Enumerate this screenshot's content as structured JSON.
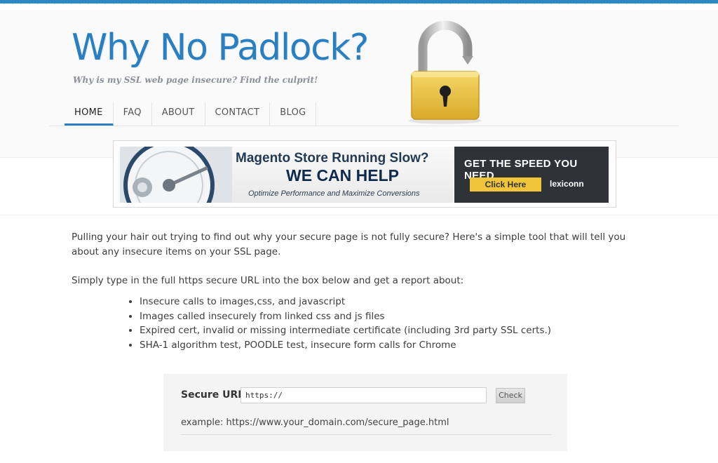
{
  "site": {
    "title": "Why No Padlock?",
    "tagline": "Why is my SSL web page insecure? Find the culprit!",
    "logo_icon": "padlock-icon"
  },
  "nav": {
    "items": [
      {
        "label": "HOME",
        "active": true
      },
      {
        "label": "FAQ"
      },
      {
        "label": "ABOUT"
      },
      {
        "label": "CONTACT"
      },
      {
        "label": "BLOG"
      }
    ]
  },
  "banner": {
    "headline": "Magento Store Running Slow?",
    "subheadline": "WE CAN HELP",
    "tagline": "Optimize Performance and Maximize Conversions",
    "speed": "GET THE SPEED YOU NEED",
    "cta": "Click Here",
    "brand": "lexiconn"
  },
  "content": {
    "intro": "Pulling your hair out trying to find out why your secure page is not fully secure? Here's a simple tool that will tell you about any insecure items on your SSL page.",
    "lead": "Simply type in the full https secure URL into the box below and get a report about:",
    "features": [
      "Insecure calls to images,css, and javascript",
      "Images called insecurely from linked css and js files",
      "Expired cert, invalid or missing intermediate certificate (including 3rd party SSL certs.)",
      "SHA-1 algorithm test, POODLE test, insecure form calls for Chrome"
    ]
  },
  "form": {
    "label": "Secure URL:",
    "input_value": "https://",
    "button": "Check",
    "example": "example: https://www.your_domain.com/secure_page.html"
  },
  "colors": {
    "brand_blue": "#2a7fc0",
    "padlock_gold": "#e9c23c",
    "banner_dark": "#2f3338",
    "cta_yellow": "#f0c53a"
  }
}
